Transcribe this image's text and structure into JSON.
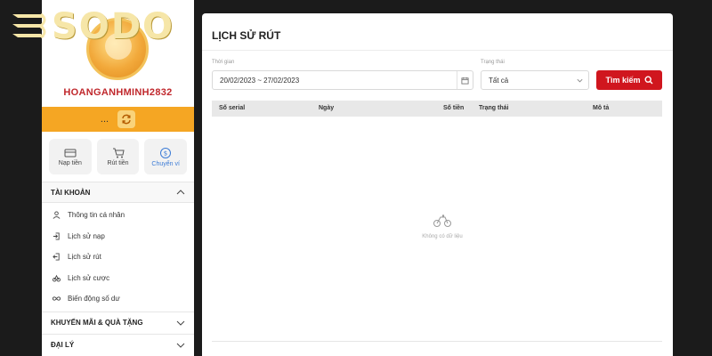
{
  "brand": {
    "logo_text": "SODO"
  },
  "user": {
    "username": "HOANGANHMINH2832",
    "balance_masked": "..."
  },
  "actions": [
    {
      "label": "Nạp tiền",
      "icon": "card-icon"
    },
    {
      "label": "Rút tiền",
      "icon": "cart-icon"
    },
    {
      "label": "Chuyển ví",
      "icon": "transfer-icon"
    }
  ],
  "account_section": {
    "title": "TÀI KHOẢN",
    "items": [
      {
        "label": "Thông tin cá nhân",
        "icon": "user-icon"
      },
      {
        "label": "Lịch sử nạp",
        "icon": "deposit-icon"
      },
      {
        "label": "Lịch sử rút",
        "icon": "withdraw-icon"
      },
      {
        "label": "Lịch sử cược",
        "icon": "bet-icon"
      },
      {
        "label": "Biến động số dư",
        "icon": "infinity-icon"
      }
    ]
  },
  "collapsed_sections": [
    {
      "title": "KHUYẾN MÃI & QUÀ TẶNG"
    },
    {
      "title": "ĐẠI LÝ"
    }
  ],
  "page": {
    "title": "LỊCH SỬ RÚT",
    "filters": {
      "time_label": "Thời gian",
      "date_range": "20/02/2023 ~ 27/02/2023",
      "status_label": "Trạng thái",
      "status_value": "Tất cả",
      "search_label": "Tìm kiếm"
    },
    "table": {
      "columns": [
        "Số serial",
        "Ngày",
        "Số tiền",
        "Trạng thái",
        "Mô tả"
      ],
      "rows": [],
      "empty_text": "Không có dữ liệu"
    }
  },
  "colors": {
    "accent_red": "#d0161e",
    "balance_orange": "#f5a623",
    "background": "#1b1b1b"
  }
}
